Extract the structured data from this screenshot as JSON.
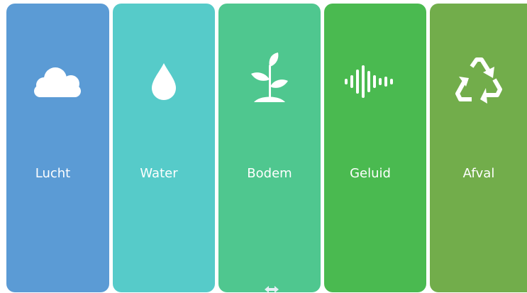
{
  "tiles": [
    {
      "label": "Lucht",
      "icon": "cloud-icon",
      "color": "#5b9bd5"
    },
    {
      "label": "Water",
      "icon": "droplet-icon",
      "color": "#56cbc9"
    },
    {
      "label": "Bodem",
      "icon": "plant-icon",
      "color": "#4fc78f"
    },
    {
      "label": "Geluid",
      "icon": "sound-wave-icon",
      "color": "#4aba50"
    },
    {
      "label": "Afval",
      "icon": "recycle-icon",
      "color": "#72ad4b"
    }
  ]
}
